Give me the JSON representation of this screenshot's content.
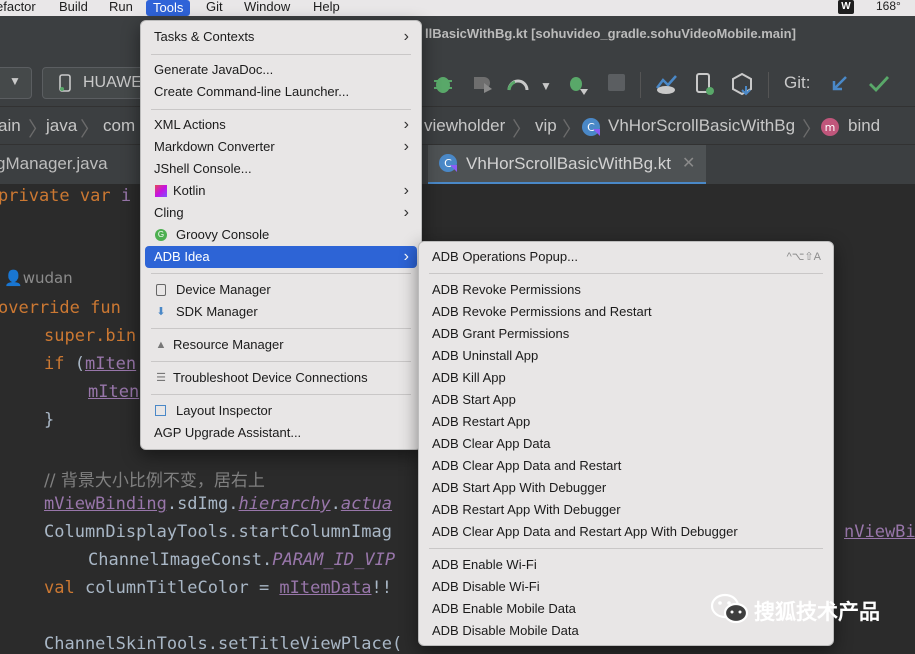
{
  "menubar": {
    "items": [
      "efactor",
      "Build",
      "Run",
      "Tools",
      "Git",
      "Window",
      "Help"
    ],
    "right_badge": "W",
    "temperature": "168°"
  },
  "titlebar": {
    "text": "llBasicWithBg.kt [sohuvideo_gradle.sohuVideoMobile.main]"
  },
  "toolbar": {
    "device": "HUAWE",
    "git_label": "Git:"
  },
  "breadcrumb": [
    "ain",
    "java",
    "com",
    "viewholder",
    "vip",
    "VhHorScrollBasicWithBg",
    "bind"
  ],
  "tabs": {
    "left": "gManager.java",
    "active": "VhHorScrollBasicWithBg.kt"
  },
  "code": {
    "l1_kw": "private var ",
    "l1_rest": "i",
    "author": "wudan",
    "l2_kw": "override fun",
    "l3": "super.bin",
    "l4_kw": "if",
    "l4_rest": " (",
    "l4_fld": "mIten",
    "l5_fld": "mIten",
    "l6": "}",
    "comment": "// 背景大小比例不变，居右上",
    "l8_a": "mViewBinding",
    "l8_b": ".sdImg.",
    "l8_c": "hierarchy",
    "l8_d": ".",
    "l8_e": "actua",
    "l9_a": "ColumnDisplayTools.startColumnImag",
    "l9_right": "nViewBin",
    "l10_a": "ChannelImageConst.",
    "l10_b": "PARAM_ID_VIP",
    "l11_kw": "val ",
    "l11_b": "columnTitleColor = ",
    "l11_c": "mItemData",
    "l11_d": "!!",
    "l12": "ChannelSkinTools.setTitleViewPlace("
  },
  "tools_menu": {
    "items": [
      {
        "label": "Tasks & Contexts",
        "arrow": true
      },
      {
        "label": "Generate JavaDoc..."
      },
      {
        "label": "Create Command-line Launcher..."
      },
      {
        "label": "XML Actions",
        "arrow": true
      },
      {
        "label": "Markdown Converter",
        "arrow": true
      },
      {
        "label": "JShell Console..."
      },
      {
        "label": "Kotlin",
        "arrow": true,
        "icon": "kotlin-icon"
      },
      {
        "label": "Cling",
        "arrow": true
      },
      {
        "label": "Groovy Console",
        "icon": "groovy-icon"
      },
      {
        "label": "ADB Idea",
        "arrow": true
      },
      {
        "label": "Device Manager",
        "icon": "device-manager-icon"
      },
      {
        "label": "SDK Manager",
        "icon": "sdk-manager-icon"
      },
      {
        "label": "Resource Manager",
        "icon": "resource-manager-icon"
      },
      {
        "label": "Troubleshoot Device Connections",
        "icon": "troubleshoot-icon"
      },
      {
        "label": "Layout Inspector",
        "icon": "layout-inspector-icon"
      },
      {
        "label": "AGP Upgrade Assistant..."
      }
    ],
    "arrow_glyph": "›"
  },
  "adb_menu": {
    "items": [
      {
        "label": "ADB Operations Popup...",
        "shortcut": "^⌥⇧A"
      },
      {
        "label": "ADB Revoke Permissions"
      },
      {
        "label": "ADB Revoke Permissions and Restart"
      },
      {
        "label": "ADB Grant Permissions"
      },
      {
        "label": "ADB Uninstall App"
      },
      {
        "label": "ADB Kill App"
      },
      {
        "label": "ADB Start App"
      },
      {
        "label": "ADB Restart App"
      },
      {
        "label": "ADB Clear App Data"
      },
      {
        "label": "ADB Clear App Data and Restart"
      },
      {
        "label": "ADB Start App With Debugger"
      },
      {
        "label": "ADB Restart App With Debugger"
      },
      {
        "label": "ADB Clear App Data and Restart App With Debugger"
      },
      {
        "label": "ADB Enable Wi-Fi"
      },
      {
        "label": "ADB Disable Wi-Fi"
      },
      {
        "label": "ADB Enable Mobile Data"
      },
      {
        "label": "ADB Disable Mobile Data"
      }
    ]
  },
  "watermark": {
    "text": "搜狐技术产品"
  },
  "colors": {
    "highlight": "#2d64d6",
    "keyword": "#cc7832",
    "field": "#9876aa",
    "function": "#ffc66d"
  }
}
